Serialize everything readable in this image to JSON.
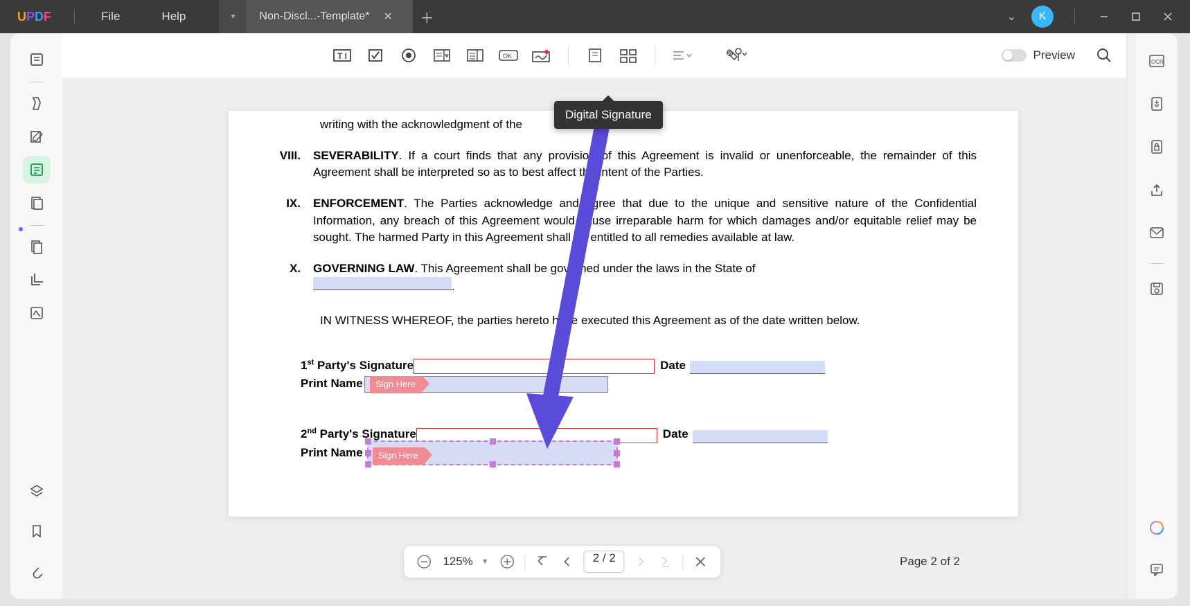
{
  "menu": {
    "file": "File",
    "help": "Help"
  },
  "tab": {
    "title": "Non-Discl...-Template*"
  },
  "avatar": {
    "initial": "K"
  },
  "tooltip": {
    "digital_signature": "Digital Signature"
  },
  "toolbar": {
    "preview": "Preview"
  },
  "doc": {
    "line_clip": "writing with the acknowledgment of the",
    "sec8": {
      "num": "VIII.",
      "title": "SEVERABILITY",
      "body": ". If a court finds that any provision of this Agreement is invalid or unenforceable, the remainder of this Agreement shall be interpreted so as to best affect the intent of the Parties."
    },
    "sec9": {
      "num": "IX.",
      "title": "ENFORCEMENT",
      "body": ". The Parties acknowledge and agree that due to the unique and sensitive nature of the Confidential Information, any breach of this Agreement would cause irreparable harm for which damages and/or equitable relief may be sought. The harmed Party in this Agreement shall be entitled to all remedies available at law."
    },
    "sec10": {
      "num": "X.",
      "title": "GOVERNING LAW",
      "body": ". This Agreement shall be governed under the laws in the State of "
    },
    "witness": "IN WITNESS WHEREOF, the parties hereto have executed this Agreement as of the date written below.",
    "party1": {
      "label_pre": "1",
      "label_sup": "st",
      "label_post": " Party's Signature",
      "date": "Date",
      "print": "Print Name",
      "sign_here": "Sign Here"
    },
    "party2": {
      "label_pre": "2",
      "label_sup": "nd",
      "label_post": " Party's Signature",
      "date": "Date",
      "print": "Print Name",
      "sign_here": "Sign Here"
    }
  },
  "bottombar": {
    "zoom": "125%",
    "page_display": "2  /  2"
  },
  "page_indicator": "Page 2 of 2"
}
